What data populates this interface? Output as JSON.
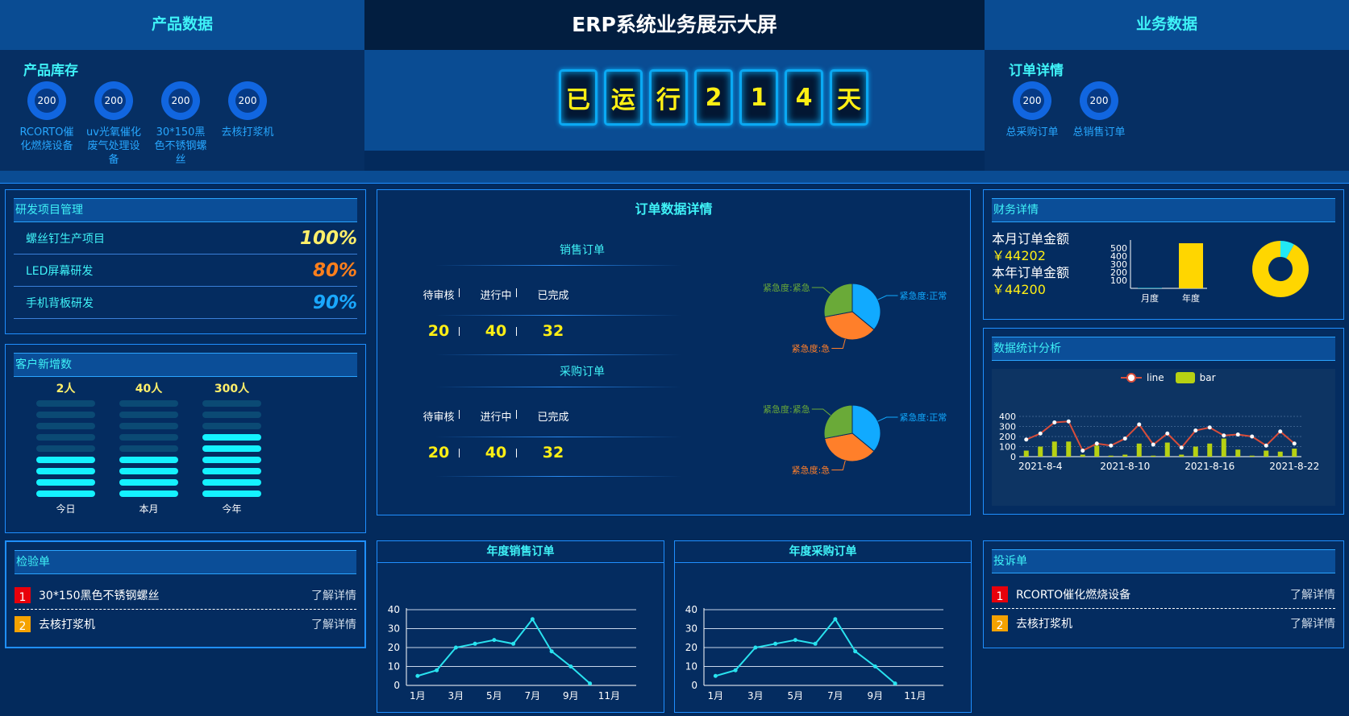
{
  "header": {
    "left_title": "产品数据",
    "center_title": "ERP系统业务展示大屏",
    "right_title": "业务数据"
  },
  "product_stock": {
    "label": "产品库存",
    "items": [
      {
        "value": "200",
        "name": "RCORTO催化燃烧设备"
      },
      {
        "value": "200",
        "name": "uv光氧催化废气处理设备"
      },
      {
        "value": "200",
        "name": "30*150黑色不锈钢螺丝"
      },
      {
        "value": "200",
        "name": "去核打浆机"
      }
    ]
  },
  "runtime": {
    "chars": [
      "已",
      "运",
      "行",
      "2",
      "1",
      "4",
      "天"
    ]
  },
  "order_detail": {
    "label": "订单详情",
    "items": [
      {
        "value": "200",
        "name": "总采购订单"
      },
      {
        "value": "200",
        "name": "总销售订单"
      }
    ]
  },
  "rd": {
    "title": "研发项目管理",
    "items": [
      {
        "name": "螺丝钉生产项目",
        "pct": "100%",
        "color": "#ffef6a"
      },
      {
        "name": "LED屏幕研发",
        "pct": "80%",
        "color": "#ff7f1c"
      },
      {
        "name": "手机背板研发",
        "pct": "90%",
        "color": "#1aa8ff"
      }
    ]
  },
  "customers": {
    "title": "客户新增数",
    "columns": [
      {
        "value": "2人",
        "label": "今日",
        "filled": 4
      },
      {
        "value": "40人",
        "label": "本月",
        "filled": 4
      },
      {
        "value": "300人",
        "label": "今年",
        "filled": 6
      }
    ],
    "total_segments": 9
  },
  "order_data": {
    "title": "订单数据详情",
    "sales": {
      "label": "销售订单",
      "headers": [
        "待审核",
        "进行中",
        "已完成"
      ],
      "values": [
        "20",
        "40",
        "32"
      ]
    },
    "purchase": {
      "label": "采购订单",
      "headers": [
        "待审核",
        "进行中",
        "已完成"
      ],
      "values": [
        "20",
        "40",
        "32"
      ]
    },
    "pie_labels": {
      "urgent_critical": "紧急度:紧急",
      "normal": "紧急度:正常",
      "urgent": "紧急度:急"
    }
  },
  "inspection": {
    "title": "检验单",
    "items": [
      {
        "no": "1",
        "name": "30*150黑色不锈钢螺丝",
        "link": "了解详情",
        "color": "#e8000b"
      },
      {
        "no": "2",
        "name": "去核打浆机",
        "link": "了解详情",
        "color": "#f5a200"
      }
    ]
  },
  "finance": {
    "title": "财务详情",
    "month_label": "本月订单金额",
    "month_value": "￥44202",
    "year_label": "本年订单金额",
    "year_value": "￥44200"
  },
  "stats": {
    "title": "数据统计分析",
    "legend_line": "line",
    "legend_bar": "bar"
  },
  "complaints": {
    "title": "投诉单",
    "items": [
      {
        "no": "1",
        "name": "RCORTO催化燃烧设备",
        "link": "了解详情",
        "color": "#e8000b"
      },
      {
        "no": "2",
        "name": "去核打浆机",
        "link": "了解详情",
        "color": "#f5a200"
      }
    ]
  },
  "annual_sales": {
    "title": "年度销售订单"
  },
  "annual_purchase": {
    "title": "年度采购订单"
  },
  "colors": {
    "accent": "#3ff2f7",
    "yellow": "#ffef14",
    "panel_border": "#1f8fff"
  },
  "chart_data": [
    {
      "type": "bar",
      "categories": [
        "月度",
        "年度"
      ],
      "values": [
        5,
        560
      ],
      "ylim": [
        0,
        560
      ],
      "yticks": [
        100,
        200,
        300,
        400,
        500
      ]
    },
    {
      "type": "pie",
      "slices": [
        {
          "name": "",
          "value": 92,
          "color": "#ffd600"
        },
        {
          "name": "",
          "value": 8,
          "color": "#22e8f5"
        }
      ],
      "hole": true
    },
    {
      "type": "pie",
      "title": "销售订单",
      "slices": [
        {
          "name": "紧急度:正常",
          "value": 36,
          "color": "#11aaff"
        },
        {
          "name": "紧急度:急",
          "value": 36,
          "color": "#ff7f2a"
        },
        {
          "name": "紧急度:紧急",
          "value": 28,
          "color": "#6aaa38"
        }
      ]
    },
    {
      "type": "pie",
      "title": "采购订单",
      "slices": [
        {
          "name": "紧急度:正常",
          "value": 36,
          "color": "#11aaff"
        },
        {
          "name": "紧急度:急",
          "value": 36,
          "color": "#ff7f2a"
        },
        {
          "name": "紧急度:紧急",
          "value": 28,
          "color": "#6aaa38"
        }
      ]
    },
    {
      "type": "line",
      "series": [
        {
          "name": "line",
          "type": "line",
          "values": [
            170,
            230,
            340,
            350,
            60,
            130,
            110,
            180,
            320,
            120,
            230,
            90,
            260,
            290,
            210,
            220,
            200,
            110,
            250,
            130
          ]
        },
        {
          "name": "bar",
          "type": "bar",
          "values": [
            60,
            100,
            150,
            150,
            20,
            110,
            10,
            20,
            130,
            10,
            140,
            20,
            100,
            130,
            180,
            70,
            10,
            60,
            50,
            80
          ]
        }
      ],
      "xticks": [
        "2021-8-4",
        "2021-8-10",
        "2021-8-16",
        "2021-8-22"
      ],
      "yticks": [
        0,
        100,
        200,
        300,
        400
      ],
      "ylim": [
        0,
        400
      ]
    },
    {
      "type": "line",
      "title": "年度销售订单",
      "x": [
        "1月",
        "2月",
        "3月",
        "4月",
        "5月",
        "6月",
        "7月",
        "8月",
        "9月",
        "10月"
      ],
      "xticks": [
        "1月",
        "3月",
        "5月",
        "7月",
        "9月",
        "11月"
      ],
      "values": [
        5,
        8,
        20,
        22,
        24,
        22,
        35,
        18,
        10,
        1
      ],
      "ylim": [
        0,
        40
      ],
      "yticks": [
        0,
        10,
        20,
        30,
        40
      ]
    },
    {
      "type": "line",
      "title": "年度采购订单",
      "x": [
        "1月",
        "2月",
        "3月",
        "4月",
        "5月",
        "6月",
        "7月",
        "8月",
        "9月",
        "10月"
      ],
      "xticks": [
        "1月",
        "3月",
        "5月",
        "7月",
        "9月",
        "11月"
      ],
      "values": [
        5,
        8,
        20,
        22,
        24,
        22,
        35,
        18,
        10,
        1
      ],
      "ylim": [
        0,
        40
      ],
      "yticks": [
        0,
        10,
        20,
        30,
        40
      ]
    }
  ]
}
